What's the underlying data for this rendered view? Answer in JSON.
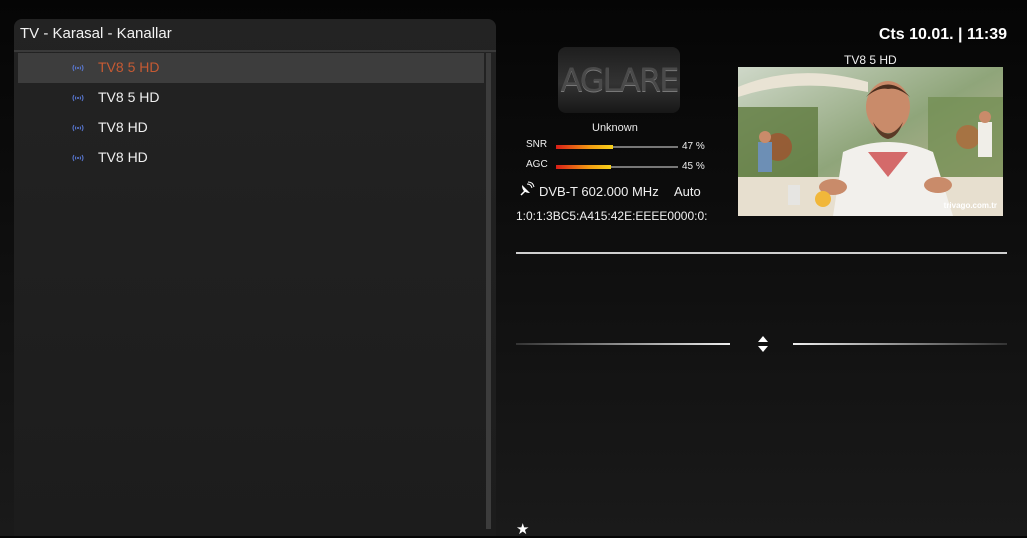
{
  "panel": {
    "title": "TV - Karasal - Kanallar"
  },
  "channels": [
    {
      "name": "TV8 5 HD",
      "icon": "antenna-icon",
      "selected": true
    },
    {
      "name": "TV8 5 HD",
      "icon": "antenna-icon",
      "selected": false
    },
    {
      "name": "TV8 HD",
      "icon": "antenna-icon",
      "selected": false
    },
    {
      "name": "TV8 HD",
      "icon": "antenna-icon",
      "selected": false
    }
  ],
  "clock": "Cts 10.01. | 11:39",
  "info": {
    "logo_text": "AGLARE",
    "provider": "Unknown",
    "snr": {
      "label": "SNR",
      "value_text": "47 %",
      "level": 0.47
    },
    "agc": {
      "label": "AGC",
      "value_text": "45 %",
      "level": 0.45
    },
    "tuner": "DVB-T 602.000 MHz",
    "mode": "Auto",
    "service_ref": "1:0:1:3BC5:A415:42E:EEEE0000:0:"
  },
  "preview": {
    "title": "TV8 5 HD",
    "watermark": "trivago.com.tr"
  },
  "colors": {
    "selected_text": "#c65a33",
    "antenna_icon": "#5b7bd9"
  }
}
